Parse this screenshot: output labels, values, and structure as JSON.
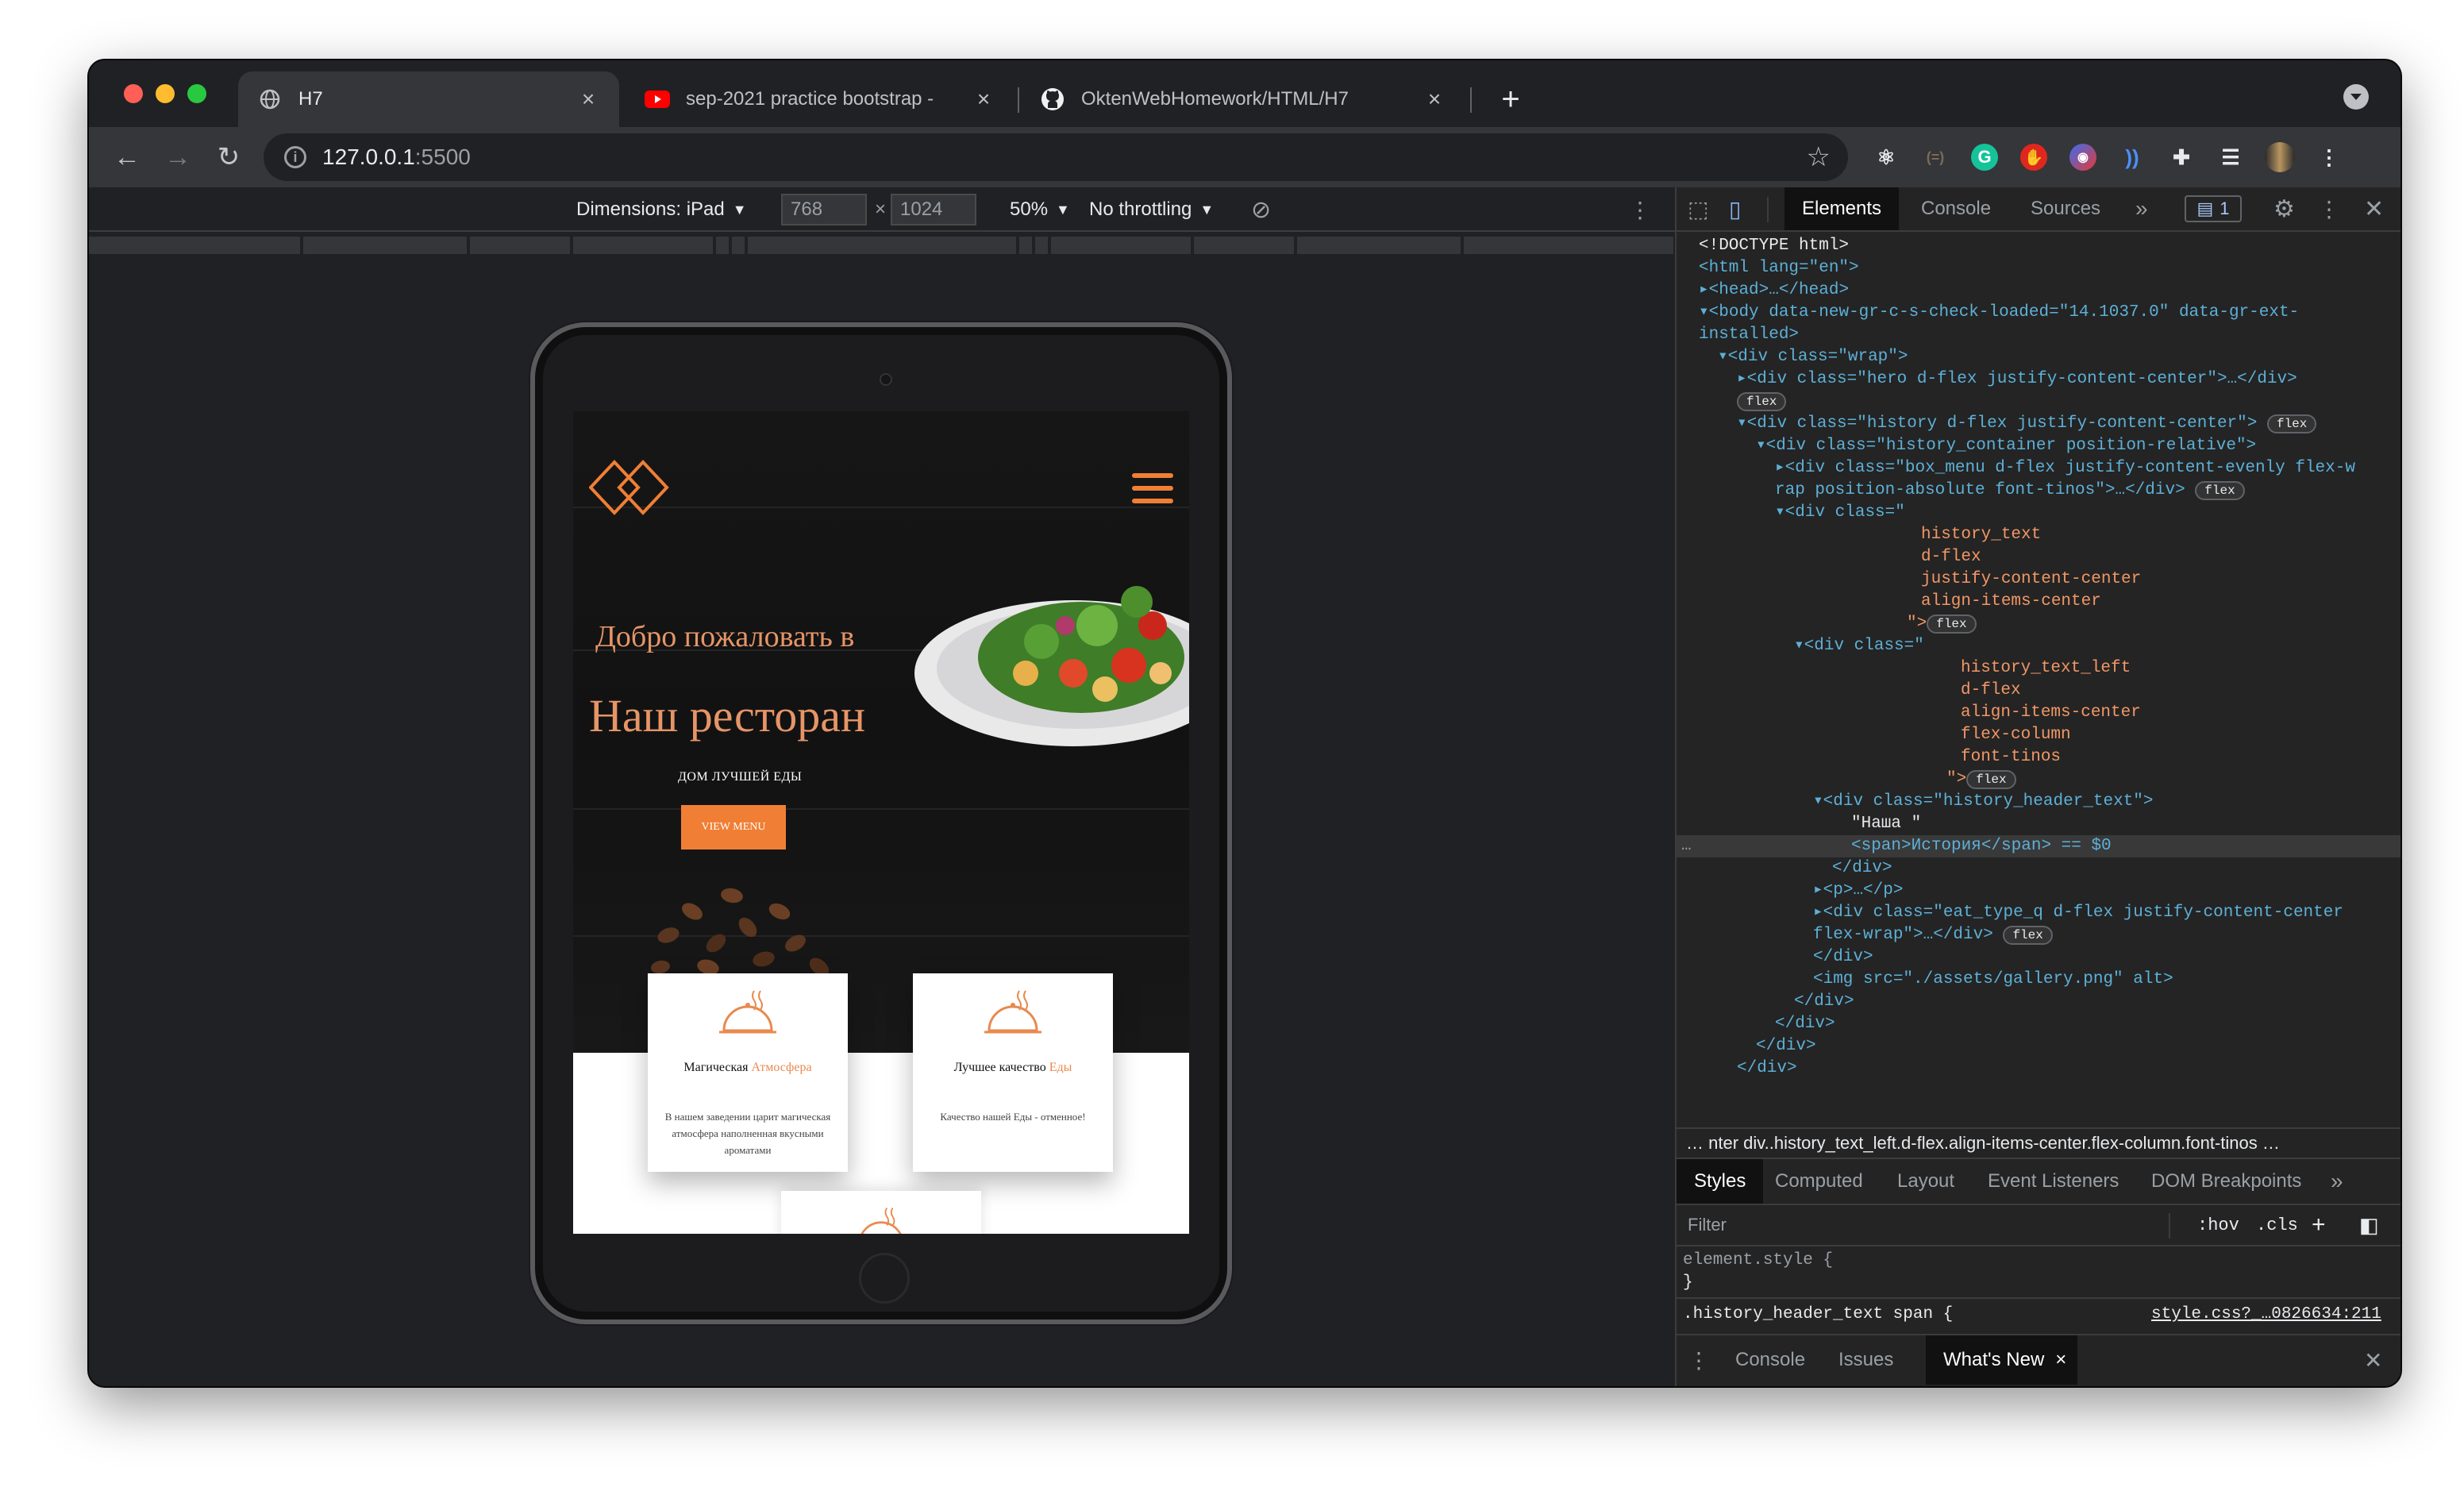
{
  "browser": {
    "tabs": [
      {
        "title": "H7",
        "icon": "globe-icon",
        "active": true
      },
      {
        "title": "sep-2021 practice bootstrap -",
        "icon": "youtube-icon",
        "active": false
      },
      {
        "title": "OktenWebHomework/HTML/H7",
        "icon": "github-icon",
        "active": false
      }
    ],
    "new_tab": "+",
    "close": "×",
    "address": {
      "host": "127.0.0.1",
      "port": ":5500"
    }
  },
  "device_toolbar": {
    "dimensions_label": "Dimensions: iPad",
    "width": "768",
    "times": "×",
    "height": "1024",
    "zoom": "50%",
    "throttling": "No throttling"
  },
  "site": {
    "welcome": "Добро пожаловать в",
    "restaurant": "Наш ресторан",
    "tagline": "ДОМ ЛУЧШЕЙ ЕДЫ",
    "menu_button": "VIEW MENU",
    "cards": [
      {
        "title": "Магическая ",
        "accent": "Атмосфера",
        "text": "В нашем заведении царит магическая атмосфера наполненная вкусными ароматами"
      },
      {
        "title": "Лучшее качество ",
        "accent": "Еды",
        "text": "Качество нашей Еды - отменное!"
      }
    ]
  },
  "devtools": {
    "tabs": [
      "Elements",
      "Console",
      "Sources"
    ],
    "more": "»",
    "issues_count": "1",
    "breadcrumb": "…  nter   div..history_text_left.d-flex.align-items-center.flex-column.font-tinos  …",
    "styles_tabs": [
      "Styles",
      "Computed",
      "Layout",
      "Event Listeners",
      "DOM Breakpoints"
    ],
    "filter_placeholder": "Filter",
    "hov": ":hov",
    "cls": ".cls",
    "element_style": "element.style {",
    "close_brace": "}",
    "rule_selector": ".history_header_text span {",
    "rule_source": "style.css?_…0826634:211",
    "drawer_tabs": [
      "Console",
      "Issues",
      "What's New"
    ],
    "dom_lines": [
      {
        "t": "<!DOCTYPE html>"
      },
      {
        "t": "<html lang=\"en\">"
      },
      {
        "t": "▸<head>…</head>"
      },
      {
        "t": "▾<body data-new-gr-c-s-check-loaded=\"14.1037.0\" data-gr-ext-"
      },
      {
        "t": "installed>"
      },
      {
        "t": "▾<div class=\"wrap\">"
      },
      {
        "t": "▸<div class=\"hero d-flex justify-content-center\">…</div>"
      },
      {
        "t": "",
        "badge": "flex"
      },
      {
        "t": "▾<div class=\"history d-flex justify-content-center\">",
        "badge": "flex"
      },
      {
        "t": "▾<div class=\"history_container position-relative\">"
      },
      {
        "t": "▸<div class=\"box_menu d-flex justify-content-evenly flex-w"
      },
      {
        "t": "rap position-absolute font-tinos\">…</div>",
        "badge": "flex"
      },
      {
        "t": "▾<div class=\""
      },
      {
        "t": "history_text"
      },
      {
        "t": "d-flex"
      },
      {
        "t": "justify-content-center"
      },
      {
        "t": "align-items-center"
      },
      {
        "t": "\">",
        "badge": "flex"
      },
      {
        "t": "▾<div class=\""
      },
      {
        "t": "history_text_left"
      },
      {
        "t": "d-flex"
      },
      {
        "t": "align-items-center"
      },
      {
        "t": "flex-column"
      },
      {
        "t": "font-tinos"
      },
      {
        "t": "\">",
        "badge": "flex"
      },
      {
        "t": "▾<div class=\"history_header_text\">"
      },
      {
        "t": "\"Наша \""
      },
      {
        "t": "<span>История</span> == $0"
      },
      {
        "t": "</div>"
      },
      {
        "t": "▸<p>…</p>"
      },
      {
        "t": "▸<div class=\"eat_type_q d-flex justify-content-center"
      },
      {
        "t": "flex-wrap\">…</div>",
        "badge": "flex"
      },
      {
        "t": "</div>"
      },
      {
        "t": "<img src=\"./assets/gallery.png\" alt>"
      },
      {
        "t": "</div>"
      },
      {
        "t": "</div>"
      },
      {
        "t": "</div>"
      },
      {
        "t": "</div>"
      }
    ]
  },
  "colors": {
    "accent": "#f07f35",
    "devtools_bg": "#242424",
    "chrome_dark": "#202124"
  }
}
